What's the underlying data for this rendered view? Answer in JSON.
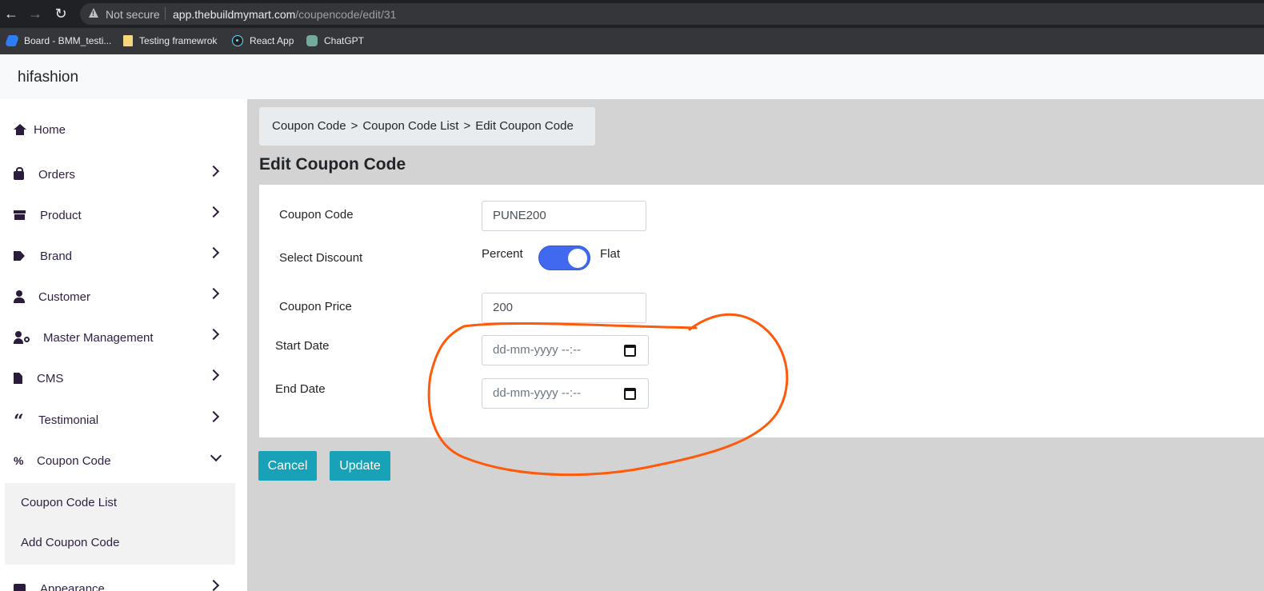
{
  "browser": {
    "security_label": "Not secure",
    "url_host": "app.thebuildmymart.com",
    "url_path": "/coupencode/edit/31",
    "bookmarks": [
      {
        "label": "Board - BMM_testi..."
      },
      {
        "label": "Testing framewrok"
      },
      {
        "label": "React App"
      },
      {
        "label": "ChatGPT"
      }
    ]
  },
  "header": {
    "brand": "hifashion"
  },
  "sidebar": {
    "items": [
      {
        "label": "Home",
        "icon": "home-icon"
      },
      {
        "label": "Orders",
        "icon": "shopping-bag-icon"
      },
      {
        "label": "Product",
        "icon": "archive-box-icon"
      },
      {
        "label": "Brand",
        "icon": "tags-icon"
      },
      {
        "label": "Customer",
        "icon": "user-icon"
      },
      {
        "label": "Master Management",
        "icon": "user-cog-icon"
      },
      {
        "label": "CMS",
        "icon": "file-icon"
      },
      {
        "label": "Testimonial",
        "icon": "quote-icon"
      },
      {
        "label": "Coupon Code",
        "icon": "percent-icon"
      },
      {
        "label": "Appearance",
        "icon": "image-icon"
      }
    ],
    "submenu": [
      {
        "label": "Coupon Code List"
      },
      {
        "label": "Add Coupon Code"
      }
    ]
  },
  "breadcrumb": {
    "items": [
      "Coupon Code",
      "Coupon Code List",
      "Edit Coupon Code"
    ],
    "separator": ">"
  },
  "page": {
    "title": "Edit Coupon Code"
  },
  "form": {
    "coupon_code_label": "Coupon Code",
    "coupon_code_value": "PUNE200",
    "discount_label": "Select Discount",
    "discount_left": "Percent",
    "discount_right": "Flat",
    "discount_selected": "Flat",
    "price_label": "Coupon Price",
    "price_value": "200",
    "start_label": "Start Date",
    "start_placeholder": "dd-mm-yyyy --:--",
    "end_label": "End Date",
    "end_placeholder": "dd-mm-yyyy --:--"
  },
  "actions": {
    "cancel": "Cancel",
    "update": "Update"
  },
  "colors": {
    "primary_button": "#17a2b8",
    "toggle_on": "#4169f0",
    "annotation_stroke": "#ff5a0a",
    "content_bg": "#d3d3d3"
  }
}
